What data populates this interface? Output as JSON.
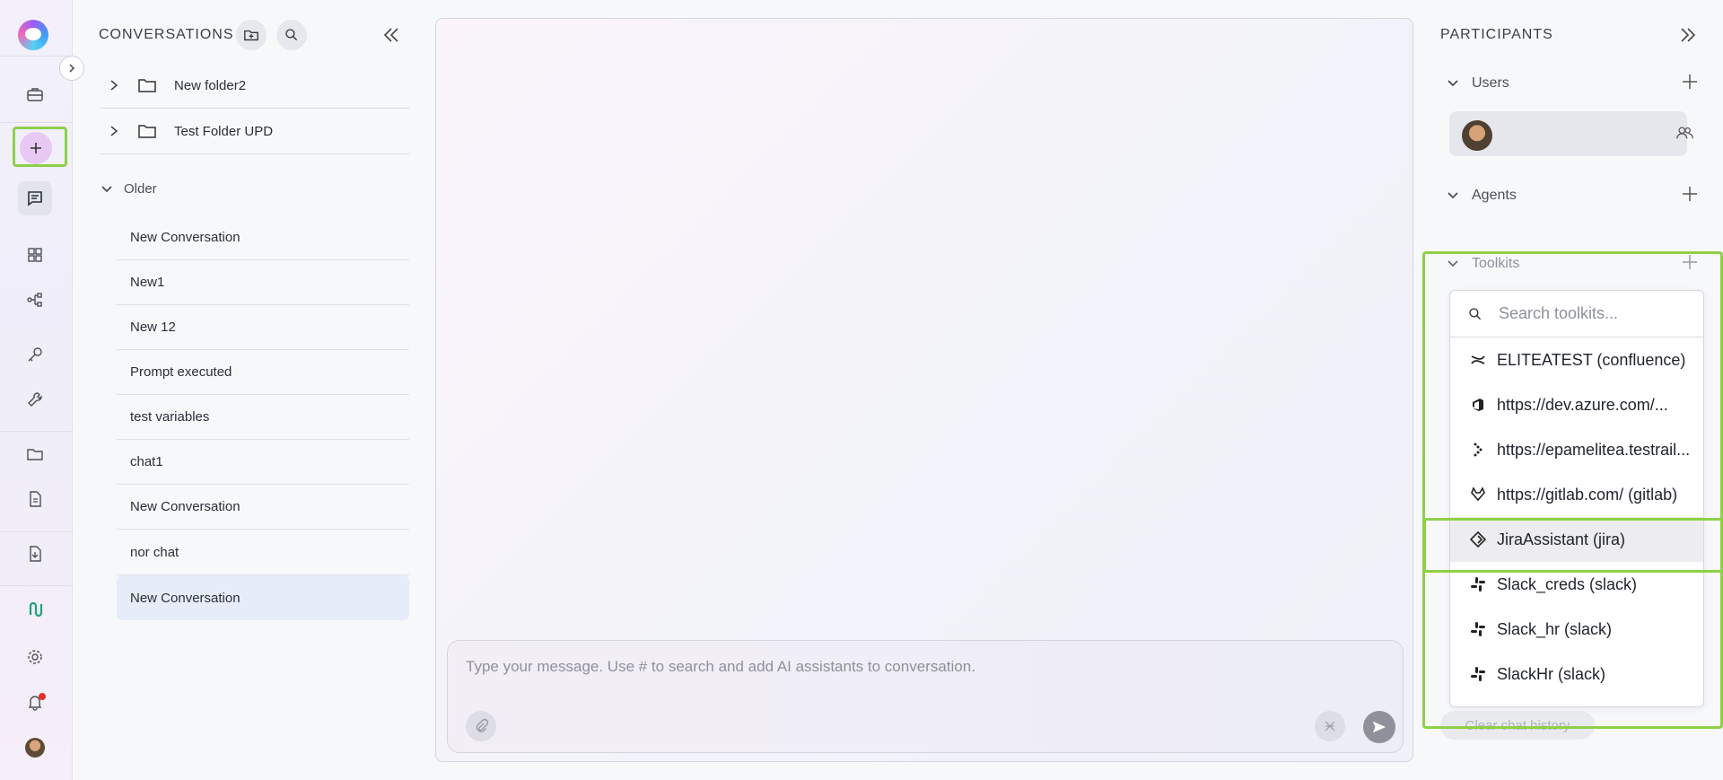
{
  "conversations": {
    "title": "CONVERSATIONS",
    "folders": [
      {
        "label": "New folder2"
      },
      {
        "label": "Test Folder UPD"
      }
    ],
    "group_label": "Older",
    "items": [
      {
        "label": "New Conversation"
      },
      {
        "label": "New1"
      },
      {
        "label": "New 12"
      },
      {
        "label": "Prompt executed"
      },
      {
        "label": "test variables"
      },
      {
        "label": "chat1"
      },
      {
        "label": "New Conversation"
      },
      {
        "label": "nor chat"
      },
      {
        "label": "New Conversation"
      }
    ]
  },
  "composer": {
    "placeholder": "Type your message. Use # to search and add AI assistants to conversation."
  },
  "participants": {
    "title": "PARTICIPANTS",
    "sections": {
      "users": "Users",
      "agents": "Agents",
      "toolkits": "Toolkits"
    },
    "toolkit_search_placeholder": "Search toolkits...",
    "toolkits": [
      {
        "label": "ELITEATEST (confluence)",
        "icon": "confluence-icon"
      },
      {
        "label": "https://dev.azure.com/...",
        "icon": "azure-devops-icon"
      },
      {
        "label": "https://epamelitea.testrail...",
        "icon": "testrail-icon"
      },
      {
        "label": "https://gitlab.com/ (gitlab)",
        "icon": "gitlab-icon"
      },
      {
        "label": "JiraAssistant (jira)",
        "icon": "jira-icon"
      },
      {
        "label": "Slack_creds (slack)",
        "icon": "slack-icon"
      },
      {
        "label": "Slack_hr (slack)",
        "icon": "slack-icon"
      },
      {
        "label": "SlackHr (slack)",
        "icon": "slack-icon"
      }
    ],
    "clear_history": "Clear chat history"
  },
  "colors": {
    "highlight": "#8ed048",
    "active_item": "#e6ecf8",
    "notification": "#e5302e"
  }
}
